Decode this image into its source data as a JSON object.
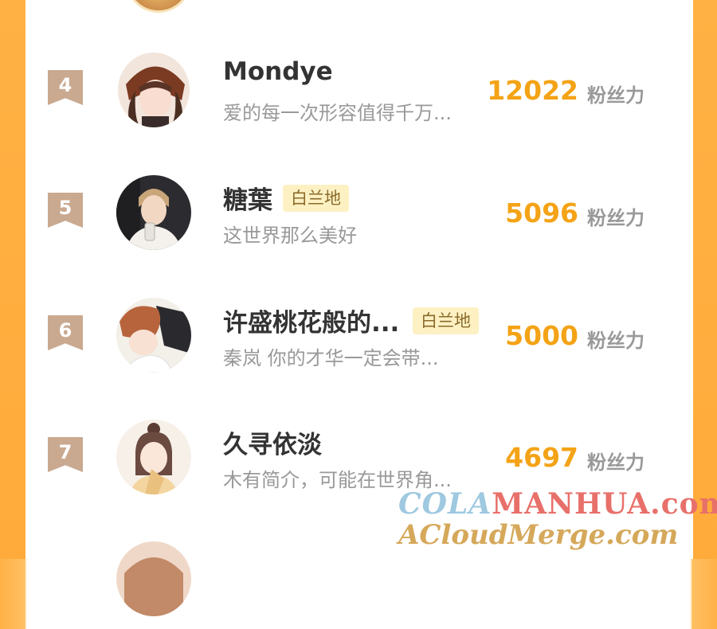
{
  "rows": [
    {
      "rank": "4",
      "name": "Mondye",
      "tag": "",
      "bio": "爱的每一次形容值得千万...",
      "score": "12022",
      "unit": "粉丝力"
    },
    {
      "rank": "5",
      "name": "糖葉",
      "tag": "白兰地",
      "bio": "这世界那么美好",
      "score": "5096",
      "unit": "粉丝力"
    },
    {
      "rank": "6",
      "name": "许盛桃花般的...",
      "tag": "白兰地",
      "bio": "秦岚 你的才华一定会带...",
      "score": "5000",
      "unit": "粉丝力"
    },
    {
      "rank": "7",
      "name": "久寻依淡",
      "tag": "",
      "bio": "木有简介，可能在世界角...",
      "score": "4697",
      "unit": "粉丝力"
    },
    {
      "rank": "",
      "name": "",
      "tag": "",
      "bio": "",
      "score": "",
      "unit": ""
    }
  ],
  "watermark": {
    "line1_a": "COLA",
    "line1_b": "MANHUA.com",
    "line2": "ACloudMerge.com"
  },
  "colors": {
    "accent": "#f4a316",
    "rank_badge": "#c9a990",
    "tag_bg": "#fdf1c3",
    "side": "#ffb143"
  }
}
